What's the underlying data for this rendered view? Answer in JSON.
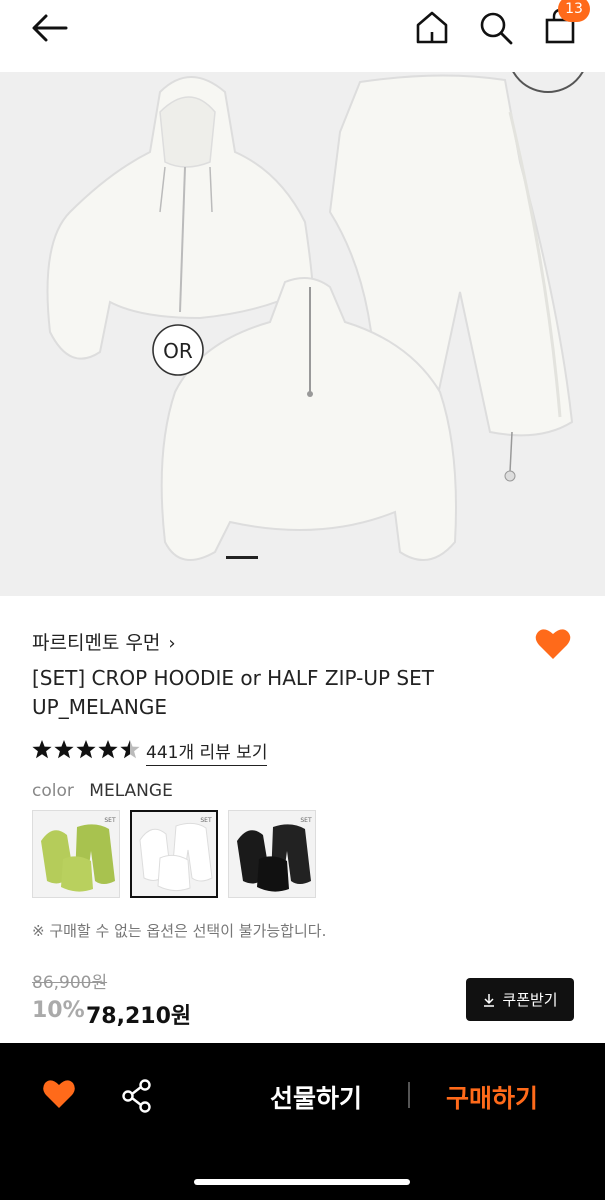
{
  "header": {
    "cart_count": "13",
    "icons": [
      "back-arrow-icon",
      "home-icon",
      "search-icon",
      "cart-icon"
    ]
  },
  "hero": {
    "overlay_label": "OR",
    "slide_index": 1
  },
  "product": {
    "brand": "파르티멘토 우먼",
    "brand_chevron": "›",
    "title": "[SET] CROP HOODIE or HALF ZIP-UP SET UP_MELANGE",
    "rating": 4.5,
    "reviews_link": "441개 리뷰 보기",
    "color_label": "color",
    "color_value": "MELANGE",
    "swatches": [
      {
        "name": "lime",
        "tag": "SET"
      },
      {
        "name": "melange",
        "tag": "SET",
        "selected": true
      },
      {
        "name": "black",
        "tag": "SET"
      }
    ],
    "note": "※ 구매할 수 없는 옵션은 선택이 불가능합니다.",
    "original_price": "86,900원",
    "discount": "10%",
    "price": "78,210원",
    "coupon_label": "쿠폰받기"
  },
  "bottom": {
    "gift_label": "선물하기",
    "buy_label": "구매하기"
  },
  "colors": {
    "accent": "#ff6a1a",
    "bar_bg": "#000000"
  }
}
